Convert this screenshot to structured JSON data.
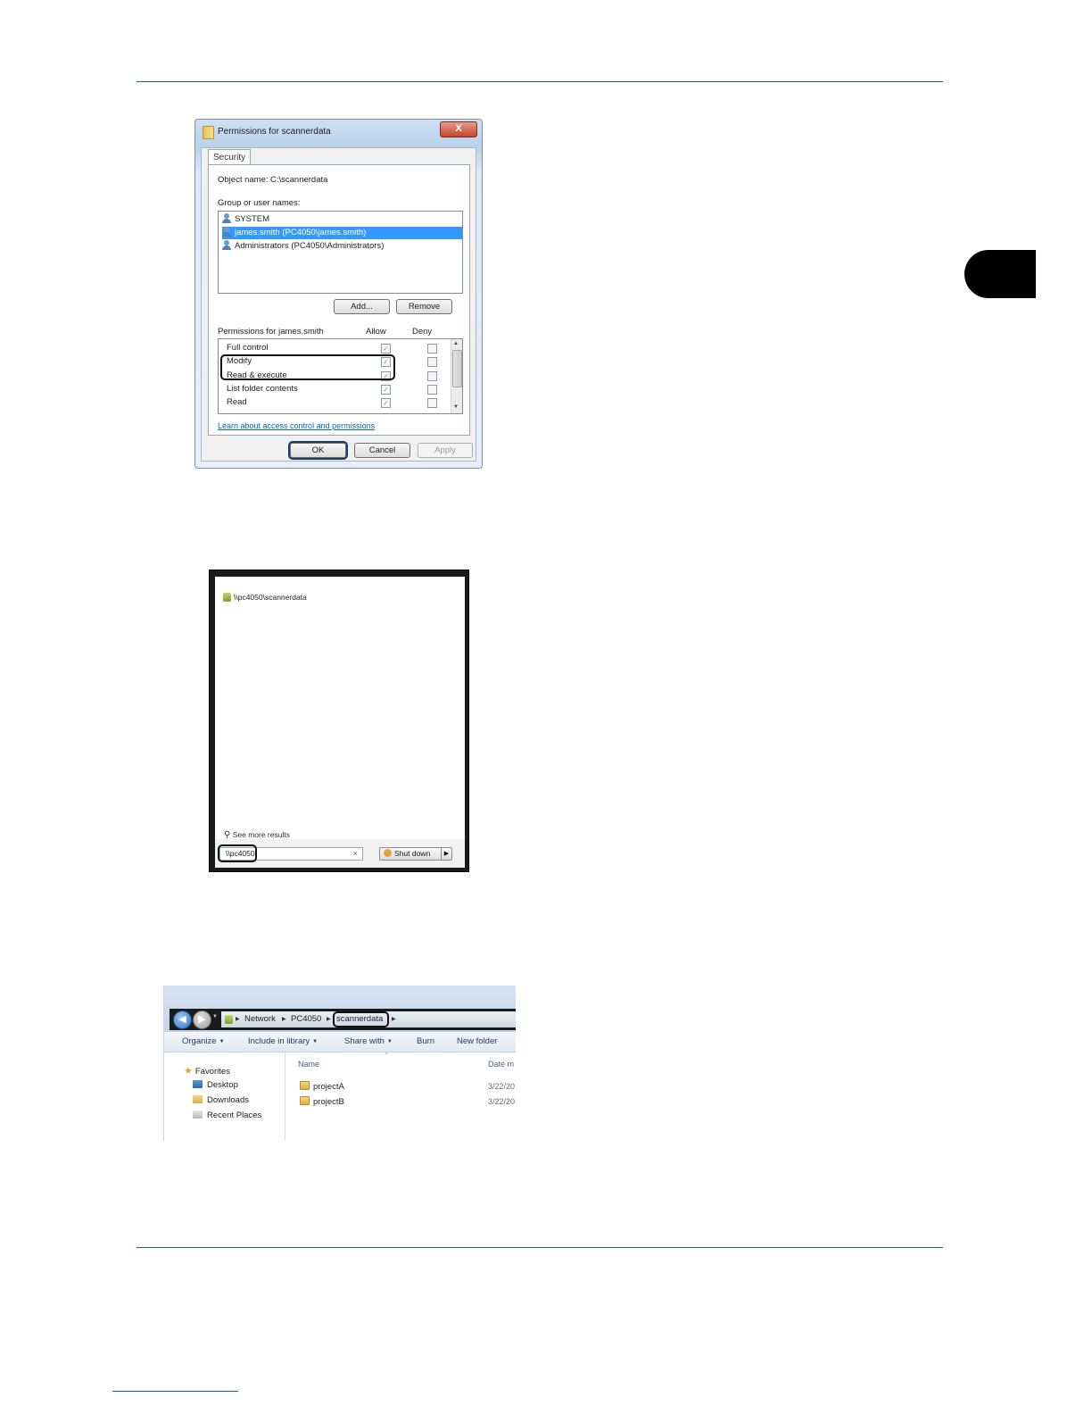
{
  "permissions_dialog": {
    "title": "Permissions for scannerdata",
    "close": "X",
    "tab": "Security",
    "object_name_label": "Object name:",
    "object_name_value": "C:\\scannerdata",
    "group_label": "Group or user names:",
    "users": [
      {
        "name": "SYSTEM",
        "selected": false
      },
      {
        "name": "james.smith (PC4050\\james.smith)",
        "selected": true
      },
      {
        "name": "Administrators (PC4050\\Administrators)",
        "selected": false
      }
    ],
    "add_button": "Add...",
    "remove_button": "Remove",
    "permissions_label": "Permissions for james.smith",
    "allow_header": "Allow",
    "deny_header": "Deny",
    "permissions": [
      {
        "name": "Full control",
        "allow": true,
        "deny": false
      },
      {
        "name": "Modify",
        "allow": true,
        "deny": false
      },
      {
        "name": "Read & execute",
        "allow": true,
        "deny": false
      },
      {
        "name": "List folder contents",
        "allow": true,
        "deny": false
      },
      {
        "name": "Read",
        "allow": true,
        "deny": false
      }
    ],
    "learn_link": "Learn about access control and permissions",
    "ok_button": "OK",
    "cancel_button": "Cancel",
    "apply_button": "Apply"
  },
  "start_menu": {
    "result": "\\\\pc4050\\scannerdata",
    "see_more": "See more results",
    "search_value": "\\\\pc4050",
    "clear": "×",
    "shutdown": "Shut down",
    "shutdown_arrow": "▶"
  },
  "explorer": {
    "breadcrumbs": [
      "Network",
      "PC4050",
      "scannerdata"
    ],
    "toolbar": [
      "Organize",
      "Include in library",
      "Share with",
      "Burn",
      "New folder"
    ],
    "nav": {
      "favorites": "Favorites",
      "items": [
        "Desktop",
        "Downloads",
        "Recent Places"
      ]
    },
    "columns": {
      "name": "Name",
      "date": "Date m"
    },
    "files": [
      {
        "name": "projectA",
        "date": "3/22/20"
      },
      {
        "name": "projectB",
        "date": "3/22/20"
      }
    ]
  },
  "colors": {
    "selection": "#3399ff",
    "link": "#0066cc",
    "rule": "#1f5f8f"
  }
}
